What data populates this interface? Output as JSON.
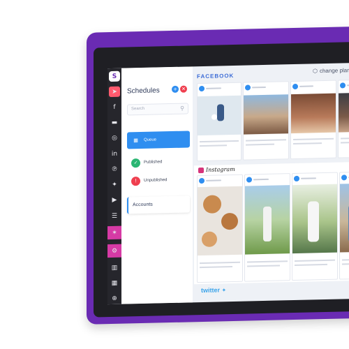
{
  "schedules": {
    "title": "Schedules",
    "search_placeholder": "Search",
    "items": [
      {
        "label": "Queue"
      },
      {
        "label": "Published"
      },
      {
        "label": "Unpublished"
      }
    ],
    "accounts": "Accounts"
  },
  "header": {
    "facebook": "FACEBOOK",
    "change_plan": "change plan"
  },
  "sections": {
    "instagram": "Instagram",
    "twitter": "twitter"
  },
  "rail_icons": [
    "app-logo-icon",
    "send-icon",
    "facebook-icon",
    "calendar-icon",
    "instagram-icon",
    "linkedin-icon",
    "pinterest-icon",
    "twitter-icon",
    "youtube-icon",
    "storage-icon",
    "brand-icon",
    "analytics-icon",
    "bar-chart-icon",
    "calendar-small-icon",
    "add-icon"
  ],
  "colors": {
    "frame": "#6a2bb3",
    "accent": "#2f8ef0",
    "published": "#2bb673",
    "unpublished": "#ef3f4f"
  }
}
